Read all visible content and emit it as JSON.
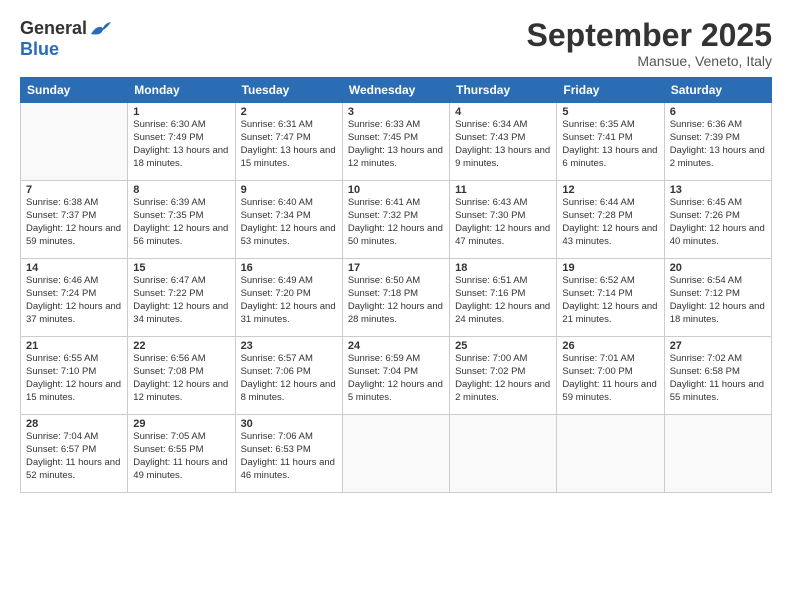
{
  "header": {
    "logo_general": "General",
    "logo_blue": "Blue",
    "month_title": "September 2025",
    "location": "Mansue, Veneto, Italy"
  },
  "weekdays": [
    "Sunday",
    "Monday",
    "Tuesday",
    "Wednesday",
    "Thursday",
    "Friday",
    "Saturday"
  ],
  "weeks": [
    [
      {
        "day": "",
        "sunrise": "",
        "sunset": "",
        "daylight": ""
      },
      {
        "day": "1",
        "sunrise": "Sunrise: 6:30 AM",
        "sunset": "Sunset: 7:49 PM",
        "daylight": "Daylight: 13 hours and 18 minutes."
      },
      {
        "day": "2",
        "sunrise": "Sunrise: 6:31 AM",
        "sunset": "Sunset: 7:47 PM",
        "daylight": "Daylight: 13 hours and 15 minutes."
      },
      {
        "day": "3",
        "sunrise": "Sunrise: 6:33 AM",
        "sunset": "Sunset: 7:45 PM",
        "daylight": "Daylight: 13 hours and 12 minutes."
      },
      {
        "day": "4",
        "sunrise": "Sunrise: 6:34 AM",
        "sunset": "Sunset: 7:43 PM",
        "daylight": "Daylight: 13 hours and 9 minutes."
      },
      {
        "day": "5",
        "sunrise": "Sunrise: 6:35 AM",
        "sunset": "Sunset: 7:41 PM",
        "daylight": "Daylight: 13 hours and 6 minutes."
      },
      {
        "day": "6",
        "sunrise": "Sunrise: 6:36 AM",
        "sunset": "Sunset: 7:39 PM",
        "daylight": "Daylight: 13 hours and 2 minutes."
      }
    ],
    [
      {
        "day": "7",
        "sunrise": "Sunrise: 6:38 AM",
        "sunset": "Sunset: 7:37 PM",
        "daylight": "Daylight: 12 hours and 59 minutes."
      },
      {
        "day": "8",
        "sunrise": "Sunrise: 6:39 AM",
        "sunset": "Sunset: 7:35 PM",
        "daylight": "Daylight: 12 hours and 56 minutes."
      },
      {
        "day": "9",
        "sunrise": "Sunrise: 6:40 AM",
        "sunset": "Sunset: 7:34 PM",
        "daylight": "Daylight: 12 hours and 53 minutes."
      },
      {
        "day": "10",
        "sunrise": "Sunrise: 6:41 AM",
        "sunset": "Sunset: 7:32 PM",
        "daylight": "Daylight: 12 hours and 50 minutes."
      },
      {
        "day": "11",
        "sunrise": "Sunrise: 6:43 AM",
        "sunset": "Sunset: 7:30 PM",
        "daylight": "Daylight: 12 hours and 47 minutes."
      },
      {
        "day": "12",
        "sunrise": "Sunrise: 6:44 AM",
        "sunset": "Sunset: 7:28 PM",
        "daylight": "Daylight: 12 hours and 43 minutes."
      },
      {
        "day": "13",
        "sunrise": "Sunrise: 6:45 AM",
        "sunset": "Sunset: 7:26 PM",
        "daylight": "Daylight: 12 hours and 40 minutes."
      }
    ],
    [
      {
        "day": "14",
        "sunrise": "Sunrise: 6:46 AM",
        "sunset": "Sunset: 7:24 PM",
        "daylight": "Daylight: 12 hours and 37 minutes."
      },
      {
        "day": "15",
        "sunrise": "Sunrise: 6:47 AM",
        "sunset": "Sunset: 7:22 PM",
        "daylight": "Daylight: 12 hours and 34 minutes."
      },
      {
        "day": "16",
        "sunrise": "Sunrise: 6:49 AM",
        "sunset": "Sunset: 7:20 PM",
        "daylight": "Daylight: 12 hours and 31 minutes."
      },
      {
        "day": "17",
        "sunrise": "Sunrise: 6:50 AM",
        "sunset": "Sunset: 7:18 PM",
        "daylight": "Daylight: 12 hours and 28 minutes."
      },
      {
        "day": "18",
        "sunrise": "Sunrise: 6:51 AM",
        "sunset": "Sunset: 7:16 PM",
        "daylight": "Daylight: 12 hours and 24 minutes."
      },
      {
        "day": "19",
        "sunrise": "Sunrise: 6:52 AM",
        "sunset": "Sunset: 7:14 PM",
        "daylight": "Daylight: 12 hours and 21 minutes."
      },
      {
        "day": "20",
        "sunrise": "Sunrise: 6:54 AM",
        "sunset": "Sunset: 7:12 PM",
        "daylight": "Daylight: 12 hours and 18 minutes."
      }
    ],
    [
      {
        "day": "21",
        "sunrise": "Sunrise: 6:55 AM",
        "sunset": "Sunset: 7:10 PM",
        "daylight": "Daylight: 12 hours and 15 minutes."
      },
      {
        "day": "22",
        "sunrise": "Sunrise: 6:56 AM",
        "sunset": "Sunset: 7:08 PM",
        "daylight": "Daylight: 12 hours and 12 minutes."
      },
      {
        "day": "23",
        "sunrise": "Sunrise: 6:57 AM",
        "sunset": "Sunset: 7:06 PM",
        "daylight": "Daylight: 12 hours and 8 minutes."
      },
      {
        "day": "24",
        "sunrise": "Sunrise: 6:59 AM",
        "sunset": "Sunset: 7:04 PM",
        "daylight": "Daylight: 12 hours and 5 minutes."
      },
      {
        "day": "25",
        "sunrise": "Sunrise: 7:00 AM",
        "sunset": "Sunset: 7:02 PM",
        "daylight": "Daylight: 12 hours and 2 minutes."
      },
      {
        "day": "26",
        "sunrise": "Sunrise: 7:01 AM",
        "sunset": "Sunset: 7:00 PM",
        "daylight": "Daylight: 11 hours and 59 minutes."
      },
      {
        "day": "27",
        "sunrise": "Sunrise: 7:02 AM",
        "sunset": "Sunset: 6:58 PM",
        "daylight": "Daylight: 11 hours and 55 minutes."
      }
    ],
    [
      {
        "day": "28",
        "sunrise": "Sunrise: 7:04 AM",
        "sunset": "Sunset: 6:57 PM",
        "daylight": "Daylight: 11 hours and 52 minutes."
      },
      {
        "day": "29",
        "sunrise": "Sunrise: 7:05 AM",
        "sunset": "Sunset: 6:55 PM",
        "daylight": "Daylight: 11 hours and 49 minutes."
      },
      {
        "day": "30",
        "sunrise": "Sunrise: 7:06 AM",
        "sunset": "Sunset: 6:53 PM",
        "daylight": "Daylight: 11 hours and 46 minutes."
      },
      {
        "day": "",
        "sunrise": "",
        "sunset": "",
        "daylight": ""
      },
      {
        "day": "",
        "sunrise": "",
        "sunset": "",
        "daylight": ""
      },
      {
        "day": "",
        "sunrise": "",
        "sunset": "",
        "daylight": ""
      },
      {
        "day": "",
        "sunrise": "",
        "sunset": "",
        "daylight": ""
      }
    ]
  ]
}
